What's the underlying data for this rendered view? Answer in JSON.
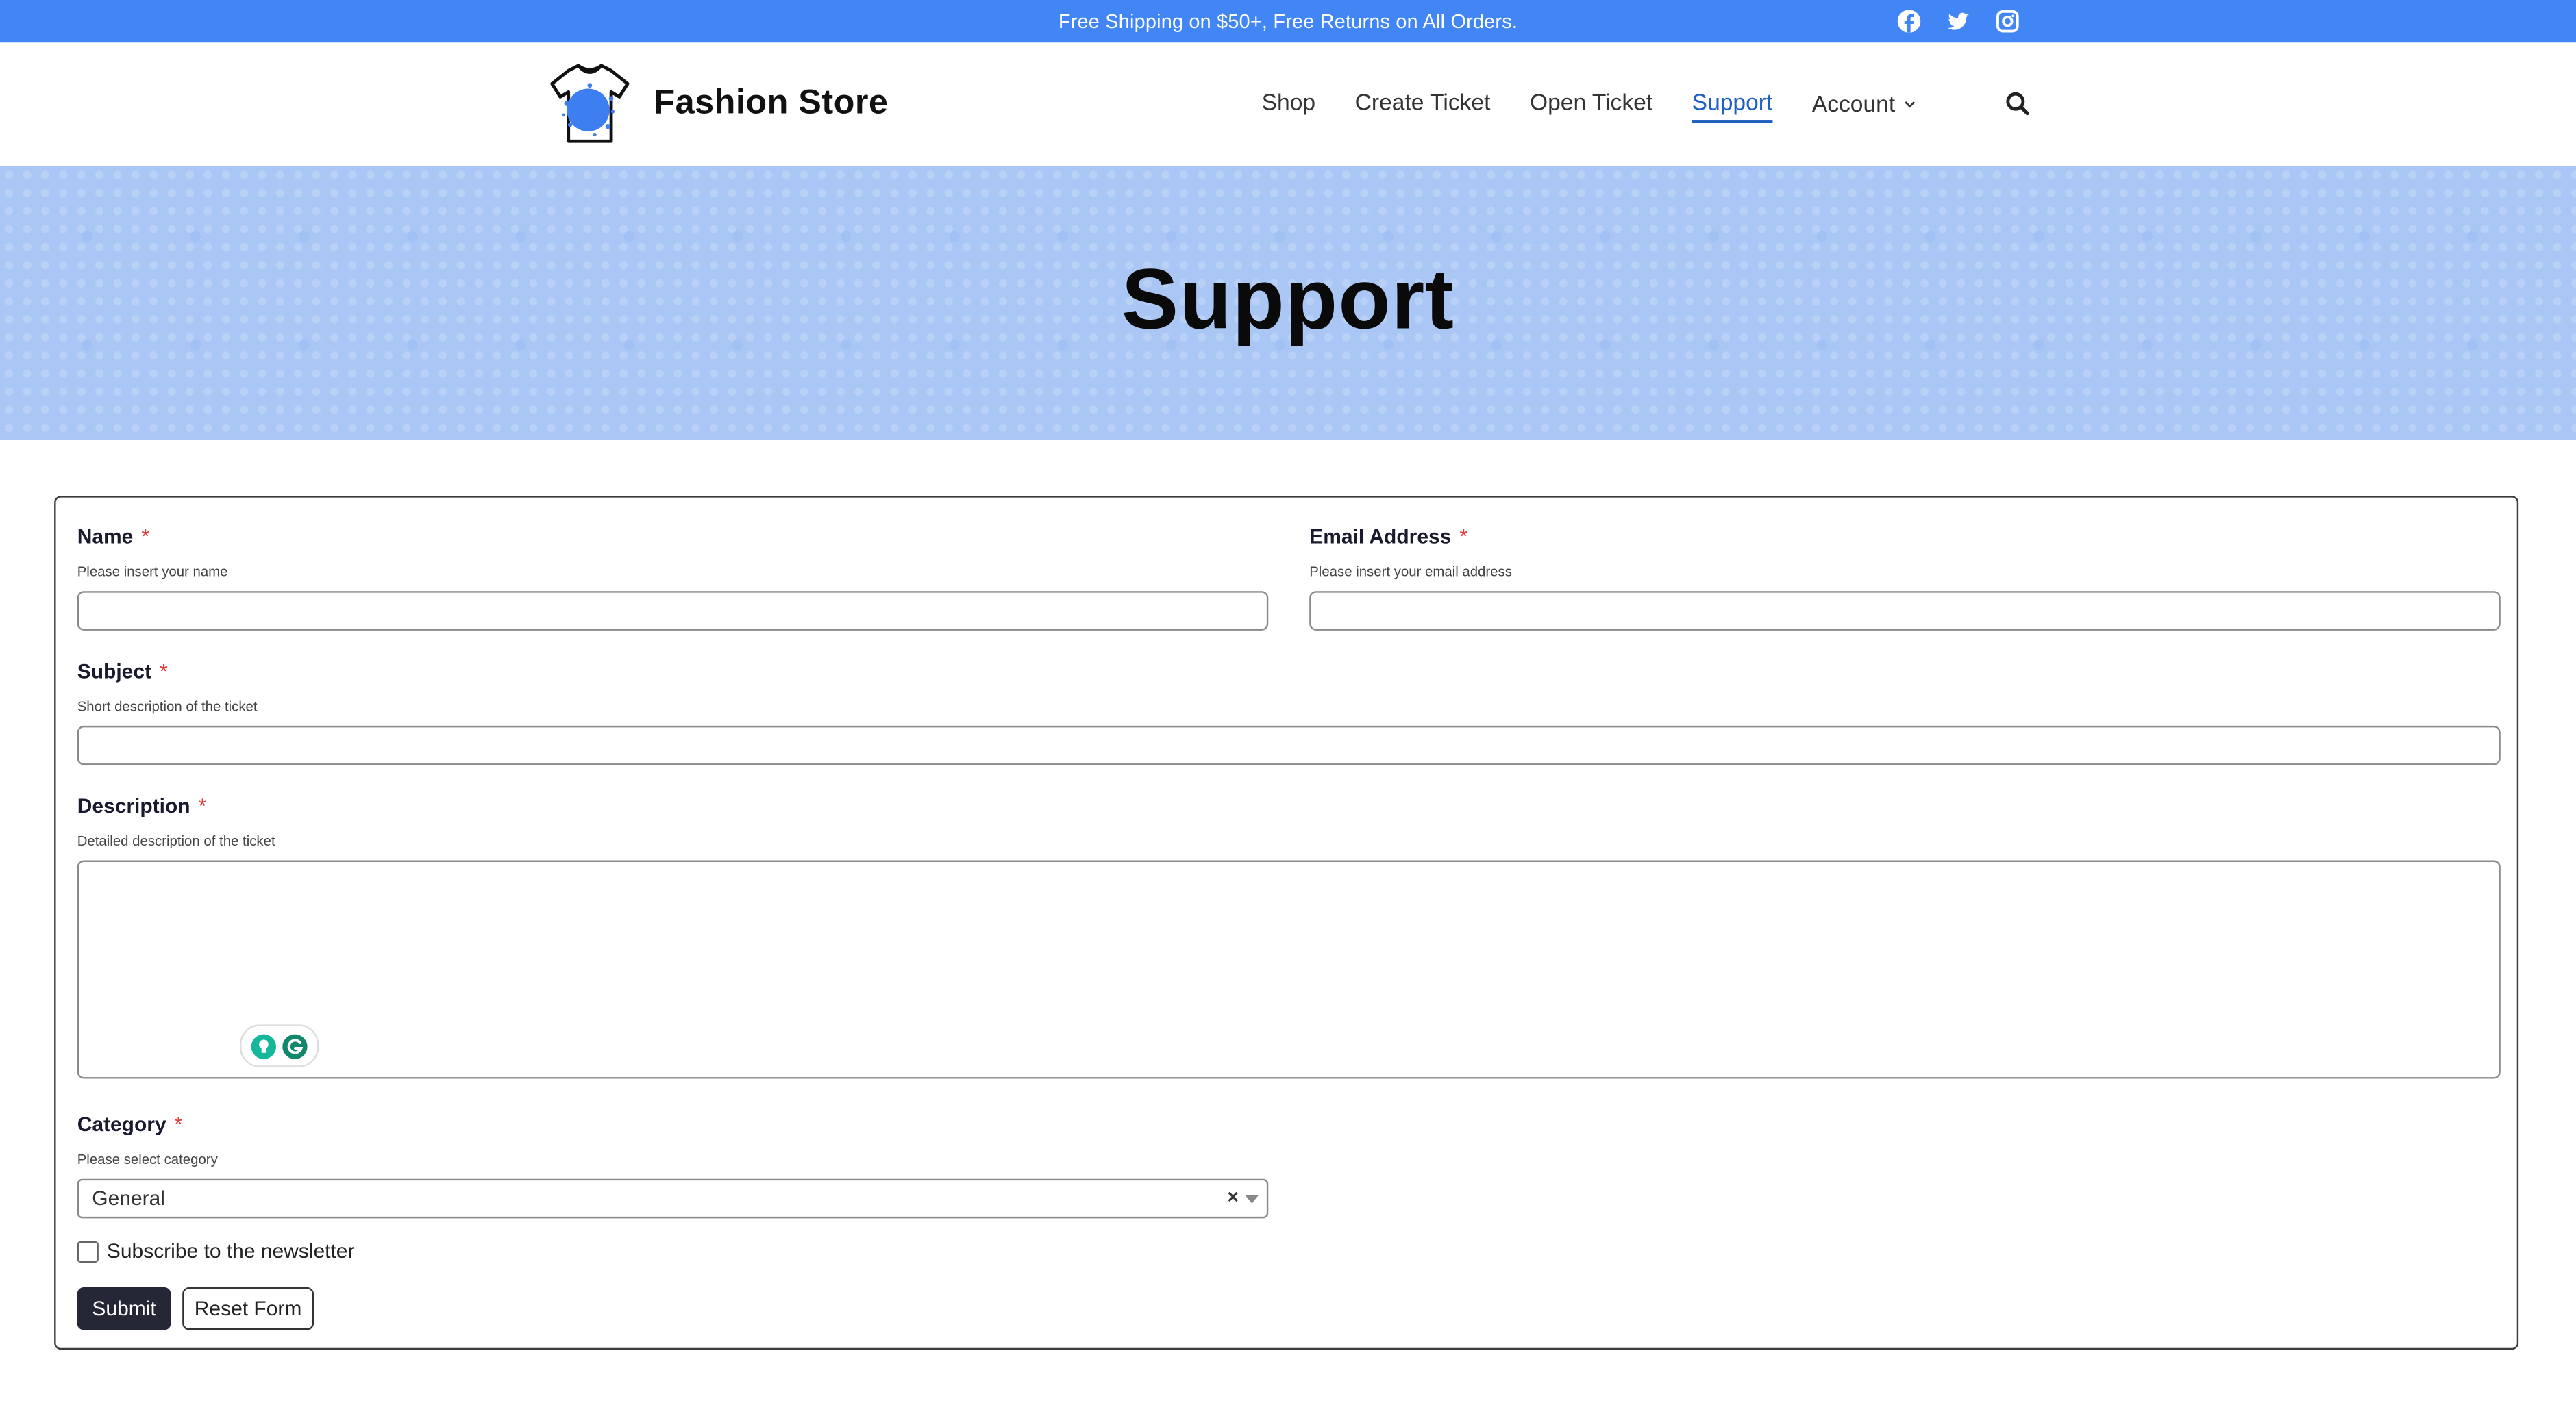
{
  "topbar": {
    "promo": "Free Shipping on $50+, Free Returns on All Orders.",
    "social": [
      "facebook-icon",
      "twitter-icon",
      "instagram-icon"
    ],
    "background": "#4285f4"
  },
  "header": {
    "brand_name": "Fashion Store",
    "nav": {
      "shop": "Shop",
      "create_ticket": "Create Ticket",
      "open_ticket": "Open Ticket",
      "support": "Support",
      "account": "Account"
    },
    "active_nav": "Support",
    "accent": "#1f5fbf"
  },
  "hero": {
    "title": "Support",
    "background": "#a9c6f5"
  },
  "form": {
    "name": {
      "label": "Name",
      "required": "*",
      "hint": "Please insert your name",
      "value": ""
    },
    "email": {
      "label": "Email Address",
      "required": "*",
      "hint": "Please insert your email address",
      "value": ""
    },
    "subject": {
      "label": "Subject",
      "required": "*",
      "hint": "Short description of the ticket",
      "value": ""
    },
    "description": {
      "label": "Description",
      "required": "*",
      "hint": "Detailed description of the ticket",
      "value": ""
    },
    "category": {
      "label": "Category",
      "required": "*",
      "hint": "Please select category",
      "selected": "General",
      "clear": "×"
    },
    "newsletter": {
      "label": "Subscribe to the newsletter",
      "checked": false
    },
    "submit_label": "Submit",
    "reset_label": "Reset Form"
  }
}
